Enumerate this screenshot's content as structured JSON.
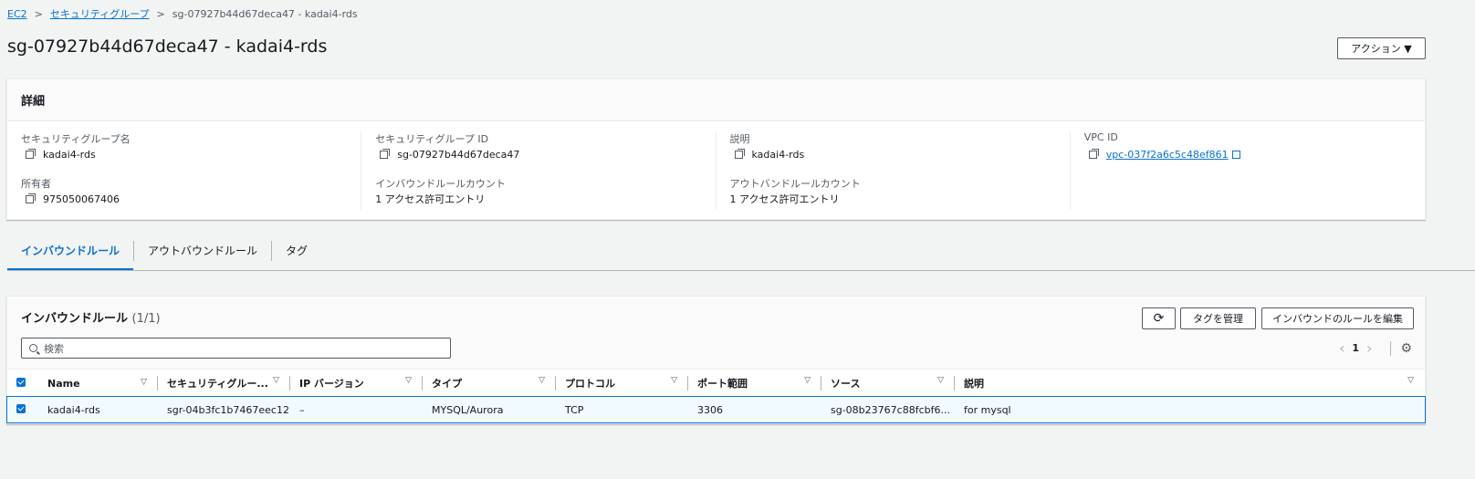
{
  "breadcrumb": {
    "root": "EC2",
    "parent": "セキュリティグループ",
    "current": "sg-07927b44d67deca47 - kadai4-rds"
  },
  "page_title": "sg-07927b44d67deca47 - kadai4-rds",
  "actions_button": "アクション ▼",
  "details": {
    "title": "詳細",
    "sg_name_label": "セキュリティグループ名",
    "sg_name": "kadai4-rds",
    "owner_label": "所有者",
    "owner": "975050067406",
    "sg_id_label": "セキュリティグループ ID",
    "sg_id": "sg-07927b44d67deca47",
    "inbound_count_label": "インバウンドルールカウント",
    "inbound_count": "1 アクセス許可エントリ",
    "desc_label": "説明",
    "desc": "kadai4-rds",
    "outbound_count_label": "アウトバンドルールカウント",
    "outbound_count": "1 アクセス許可エントリ",
    "vpc_label": "VPC ID",
    "vpc": "vpc-037f2a6c5c48ef861"
  },
  "tabs": [
    "インバウンドルール",
    "アウトバウンドルール",
    "タグ"
  ],
  "rules": {
    "title": "インバウンドルール",
    "count": "(1/1)",
    "refresh_icon": "⟳",
    "manage_tags": "タグを管理",
    "edit_rules": "インバウンドのルールを編集",
    "search_placeholder": "検索",
    "page": "1",
    "columns": [
      "Name",
      "セキュリティグルー...",
      "IP バージョン",
      "タイプ",
      "プロトコル",
      "ポート範囲",
      "ソース",
      "説明"
    ],
    "rows": [
      [
        "kadai4-rds",
        "sgr-04b3fc1b7467eec12",
        "–",
        "MYSQL/Aurora",
        "TCP",
        "3306",
        "sg-08b23767c88fcbf6...",
        "for mysql"
      ]
    ]
  }
}
